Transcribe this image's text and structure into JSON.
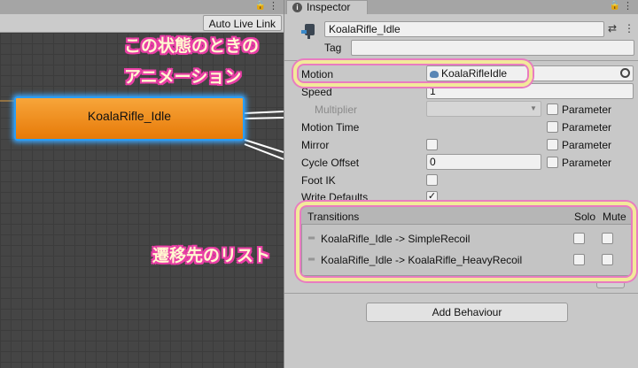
{
  "animator": {
    "toolbar_button": "Auto Live Link",
    "state_name": "KoalaRifle_Idle",
    "tab_lock": "🔒",
    "tab_menu": "⋮"
  },
  "inspector": {
    "tab_title": "Inspector",
    "tab_lock": "🔒",
    "tab_menu": "⋮",
    "header_icons": [
      "⇄",
      "⋮"
    ],
    "state_name": "KoalaRifle_Idle",
    "tag_label": "Tag",
    "tag_value": "",
    "rows": {
      "motion": {
        "label": "Motion",
        "value": "KoalaRifleIdle"
      },
      "speed": {
        "label": "Speed",
        "value": "1"
      },
      "multiplier": {
        "label": "Multiplier",
        "param_label": "Parameter"
      },
      "motion_time": {
        "label": "Motion Time",
        "param_label": "Parameter"
      },
      "mirror": {
        "label": "Mirror",
        "param_label": "Parameter"
      },
      "cycle_offset": {
        "label": "Cycle Offset",
        "value": "0",
        "param_label": "Parameter"
      },
      "foot_ik": {
        "label": "Foot IK"
      },
      "write_defaults": {
        "label": "Write Defaults",
        "checked_mark": "✓"
      }
    },
    "transitions": {
      "title": "Transitions",
      "col_solo": "Solo",
      "col_mute": "Mute",
      "items": [
        {
          "label": "KoalaRifle_Idle -> SimpleRecoil"
        },
        {
          "label": "KoalaRifle_Idle -> KoalaRifle_HeavyRecoil"
        }
      ]
    },
    "add_behaviour": "Add Behaviour"
  },
  "annotations": {
    "motion_line1": "この状態のときの",
    "motion_line2": "アニメーション",
    "transitions": "遷移先のリスト"
  },
  "colors": {
    "annotation_outline": "#e83ea5",
    "state_node": "#f0920f",
    "selection_glow": "#3aa7ff"
  }
}
